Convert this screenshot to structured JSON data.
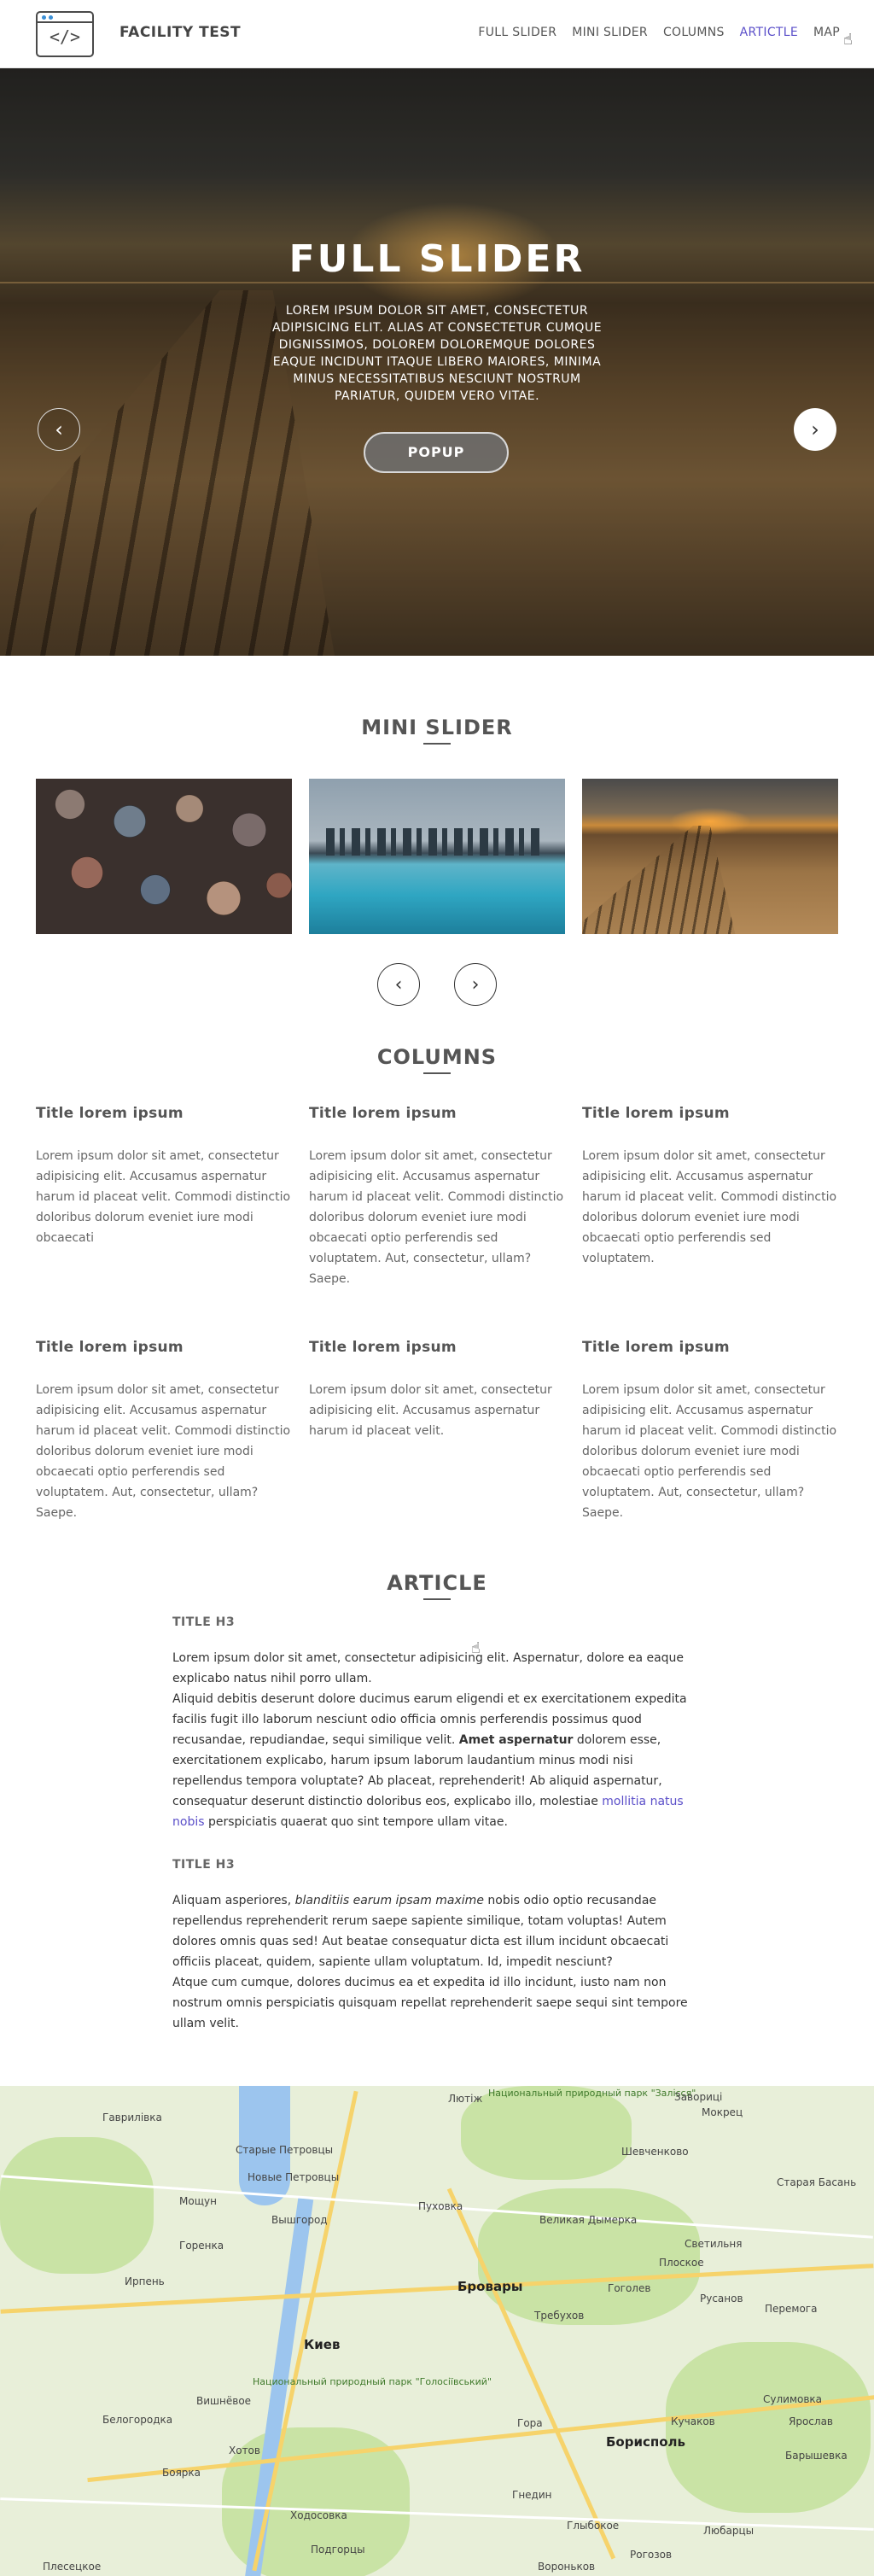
{
  "header": {
    "brand": "FACILITY TEST",
    "logo_glyph": "</>",
    "nav": [
      {
        "label": "FULL SLIDER",
        "active": false
      },
      {
        "label": "MINI SLIDER",
        "active": false
      },
      {
        "label": "COLUMNS",
        "active": false
      },
      {
        "label": "ARTICTLE",
        "active": true
      },
      {
        "label": "MAP",
        "active": false
      }
    ]
  },
  "hero": {
    "title": "FULL SLIDER",
    "text": "LOREM IPSUM DOLOR SIT AMET, CONSECTETUR ADIPISICING ELIT. ALIAS AT CONSECTETUR CUMQUE DIGNISSIMOS, DOLOREM DOLOREMQUE DOLORES EAQUE INCIDUNT ITAQUE LIBERO MAIORES, MINIMA MINUS NECESSITATIBUS NESCIUNT NOSTRUM PARIATUR, QUIDEM VERO VITAE.",
    "button": "POPUP",
    "prev_icon": "‹",
    "next_icon": "›",
    "dots": 3,
    "active_dot": 2
  },
  "mini_slider": {
    "title": "MINI SLIDER",
    "images": [
      "stones-photo",
      "city-waterfront-photo",
      "boardwalk-sunset-photo"
    ],
    "prev_icon": "‹",
    "next_icon": "›"
  },
  "columns": {
    "title": "COLUMNS",
    "items": [
      {
        "title": "Title lorem ipsum",
        "text": "Lorem ipsum dolor sit amet, consectetur adipisicing elit. Accusamus aspernatur harum id placeat velit. Commodi distinctio doloribus dolorum eveniet iure modi obcaecati"
      },
      {
        "title": "Title lorem ipsum",
        "text": "Lorem ipsum dolor sit amet, consectetur adipisicing elit. Accusamus aspernatur harum id placeat velit. Commodi distinctio doloribus dolorum eveniet iure modi obcaecati optio perferendis sed voluptatem. Aut, consectetur, ullam? Saepe."
      },
      {
        "title": "Title lorem ipsum",
        "text": "Lorem ipsum dolor sit amet, consectetur adipisicing elit. Accusamus aspernatur harum id placeat velit. Commodi distinctio doloribus dolorum eveniet iure modi obcaecati optio perferendis sed voluptatem."
      },
      {
        "title": "Title lorem ipsum",
        "text": "Lorem ipsum dolor sit amet, consectetur adipisicing elit. Accusamus aspernatur harum id placeat velit. Commodi distinctio doloribus dolorum eveniet iure modi obcaecati optio perferendis sed voluptatem. Aut, consectetur, ullam? Saepe."
      },
      {
        "title": "Title lorem ipsum",
        "text": "Lorem ipsum dolor sit amet, consectetur adipisicing elit. Accusamus aspernatur harum id placeat velit."
      },
      {
        "title": "Title lorem ipsum",
        "text": "Lorem ipsum dolor sit amet, consectetur adipisicing elit. Accusamus aspernatur harum id placeat velit. Commodi distinctio doloribus dolorum eveniet iure modi obcaecati optio perferendis sed voluptatem. Aut, consectetur, ullam? Saepe."
      }
    ]
  },
  "article": {
    "title": "ARTICLE",
    "h3_1": "TITLE H3",
    "p1": "Lorem ipsum dolor sit amet, consectetur adipisicing elit. Aspernatur, dolore ea eaque explicabo natus nihil porro ullam.",
    "p2_a": "Aliquid debitis deserunt dolore ducimus earum eligendi et ex exercitationem expedita facilis fugit illo laborum nesciunt odio officia omnis perferendis possimus quod recusandae, repudiandae, sequi similique velit. ",
    "p2_bold": "Amet aspernatur",
    "p2_b": " dolorem esse, exercitationem explicabo, harum ipsum laborum laudantium minus modi nisi repellendus tempora voluptate? Ab placeat, reprehenderit! Ab aliquid aspernatur, consequatur deserunt distinctio doloribus eos, explicabo illo, molestiae ",
    "p2_link": "mollitia natus nobis",
    "p2_c": " perspiciatis quaerat quo sint tempore ullam vitae.",
    "h3_2": "TITLE H3",
    "p3_a": "Aliquam asperiores, ",
    "p3_italic": "blanditiis earum ipsam maxime",
    "p3_b": " nobis odio optio recusandae repellendus reprehenderit rerum saepe sapiente similique, totam voluptas! Autem dolores omnis quas sed! Aut beatae consequatur dicta est illum incidunt obcaecati officiis placeat, quidem, sapiente ullam voluptatum. Id, impedit nesciunt?",
    "p4": "Atque cum cumque, dolores ducimus ea et expedita id illo incidunt, iusto nam non nostrum omnis perspiciatis quisquam repellat reprehenderit saepe sequi sint tempore ullam velit."
  },
  "map": {
    "labels": [
      "Национальный природный парк \"Залісся\"",
      "Гаврилівка",
      "Лютіж",
      "Завориці",
      "Мокрец",
      "Старые Петровцы",
      "Новые Петровцы",
      "Шевченково",
      "Мощун",
      "Вышгород",
      "Пуховка",
      "Великая Дымерка",
      "Старая Басань",
      "Горенка",
      "Ирпень",
      "Бровары",
      "Гоголев",
      "Светильня",
      "Плоское",
      "Русанов",
      "Перемога",
      "Киев",
      "Вишнёвое",
      "Борисполь",
      "Боярка",
      "Белогородка",
      "Хотов",
      "Подгорцы",
      "Гора",
      "Кучаков",
      "Требухов",
      "Национальный природный парк \"Голосіївський\"",
      "Ходосовка",
      "Глыбокое",
      "Рогозов",
      "Гнедин",
      "Любарцы",
      "Плесецкое",
      "Вороньков",
      "Сулимовка",
      "Барышевка",
      "Ярослав"
    ]
  }
}
